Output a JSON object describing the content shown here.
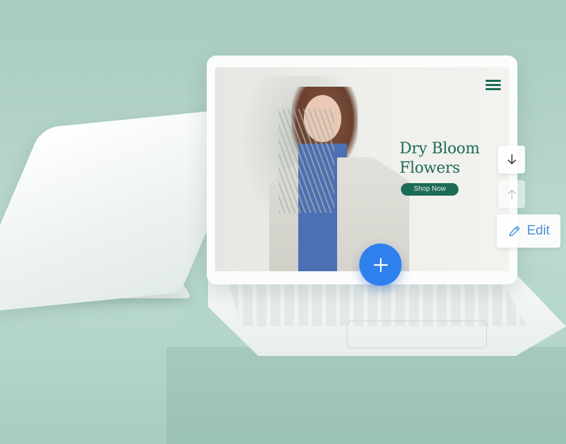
{
  "hero": {
    "title_line1": "Dry Bloom",
    "title_line2": "Flowers",
    "cta_label": "Shop Now"
  },
  "editor": {
    "edit_label": "Edit"
  },
  "icons": {
    "menu": "hamburger-menu-icon",
    "down": "arrow-down-icon",
    "up": "arrow-up-icon",
    "edit": "pencil-icon",
    "add": "plus-icon"
  },
  "colors": {
    "brand_green": "#1d6b57",
    "add_button_blue": "#2f80ed",
    "edit_blue": "#4b8fd8",
    "background_mint": "#b7d6cd"
  }
}
